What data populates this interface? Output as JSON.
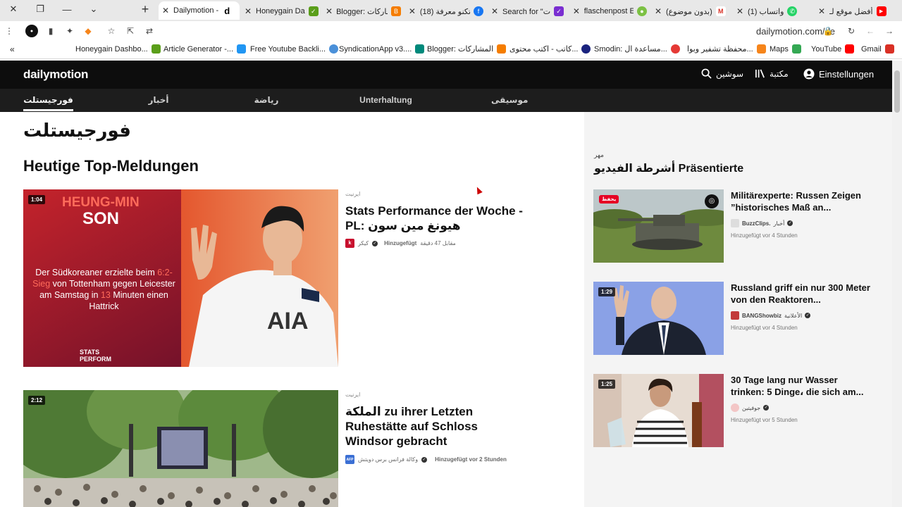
{
  "browser": {
    "tabs": [
      {
        "title": "Dailymotion -",
        "fav": "d",
        "favColor": "#fff",
        "active": true
      },
      {
        "title": "Honeygain Da",
        "fav": "✓",
        "favColor": "#5a9e1a"
      },
      {
        "title": "Blogger: مشاركات",
        "fav": "B",
        "favColor": "#f57d00"
      },
      {
        "title": "(18) تكنو معرفة",
        "fav": "f",
        "favColor": "#1877f2"
      },
      {
        "title": "Search for \"ت",
        "fav": "✓",
        "favColor": "#7a2ed1"
      },
      {
        "title": "flaschenpost E",
        "fav": "●",
        "favColor": "#7cc143"
      },
      {
        "title": "(بدون موضوع)",
        "fav": "M",
        "favColor": "#d93025"
      },
      {
        "title": "(1) واتساب",
        "fav": "✆",
        "favColor": "#25d366"
      },
      {
        "title": "أفضل موقع لـ",
        "fav": "▶",
        "favColor": "#ff0000"
      }
    ],
    "url": "dailymotion.com/de",
    "bookmarks": [
      {
        "label": "Honeygain Dashbo...",
        "color": "#5a9e1a"
      },
      {
        "label": "Article Generator -...",
        "color": "#2196f3"
      },
      {
        "label": "Free Youtube Backli...",
        "color": "#4a90d9"
      },
      {
        "label": "SyndicationApp v3....",
        "color": "#00897b"
      },
      {
        "label": "Blogger: المشاركات",
        "color": "#f57d00"
      },
      {
        "label": "كاتب - اكتب محتوى...",
        "color": "#1a237e"
      },
      {
        "label": "Smodin: مساعدة ال...",
        "color": "#e53935"
      },
      {
        "label": "محفظة تشفير وبوا...",
        "color": "#f6851b"
      },
      {
        "label": "Maps",
        "color": "#34a853"
      },
      {
        "label": "YouTube",
        "color": "#ff0000"
      },
      {
        "label": "Gmail",
        "color": "#d93025"
      }
    ]
  },
  "header": {
    "logo": "dailymotion",
    "search": "سوشين",
    "library": "مكتبة",
    "settings": "Einstellungen"
  },
  "nav": {
    "categories": [
      "فورجيستلت",
      "أخبار",
      "رياضة",
      "Unterhaltung",
      "موسيقى"
    ]
  },
  "main": {
    "page_title": "فورجيستلت",
    "section_title": "Heutige Top-Meldungen",
    "stories": [
      {
        "duration": "1:04",
        "category": "ايرنيت",
        "title": "Stats Performance der Woche - PL: هيونغ مين سون",
        "channel": "كيكر",
        "channel_color": "#c8102e",
        "channel_logo": "k",
        "added": "Hinzugefügt",
        "ago": "مقابل 47 دقيقة",
        "thumb_text": {
          "name_line1": "HEUNG-MIN",
          "name_line2": "SON",
          "desc_a": "Der Südkoreaner erzielte beim ",
          "desc_hl1": "6:2-Sieg",
          "desc_b": " von Tottenham gegen Leicester am Samstag in ",
          "desc_hl2": "13",
          "desc_c": " Minuten einen Hattrick",
          "brand": "STATS PERFORM",
          "shirt": "AIA"
        }
      },
      {
        "duration": "2:12",
        "category": "ايرنيت",
        "title": "الملكة zu ihrer Letzten Ruhestätte auf Schloss Windsor gebracht",
        "channel": "وكالة فرانس برس دويتش",
        "channel_color": "#3b6fd4",
        "channel_logo": "AFP",
        "added": "Hinzugefügt vor 2 Stunden"
      }
    ]
  },
  "sidebar": {
    "small": "مهر",
    "title": "أشرطة الفيديو Präsentierte",
    "items": [
      {
        "duration": "",
        "badge": "يحفظ",
        "title": "Militärexperte: Russen Zeigen ”historisches Maß an...",
        "channel": "BuzzClips.",
        "category": "أخبار",
        "date": "Hinzugefügt vor 4 Stunden"
      },
      {
        "duration": "1:29",
        "title": "Russland griff ein nur 300 Meter von den Reaktoren...",
        "channel": "BANGShowbiz",
        "category": "الأعلانية",
        "date": "Hinzugefügt vor 4 Stunden"
      },
      {
        "duration": "1:25",
        "title": "30 Tage lang nur Wasser trinken: 5 Dinge، die sich am...",
        "channel": "جوفيتين",
        "category": "",
        "date": "Hinzugefügt vor 5 Stunden"
      }
    ]
  }
}
